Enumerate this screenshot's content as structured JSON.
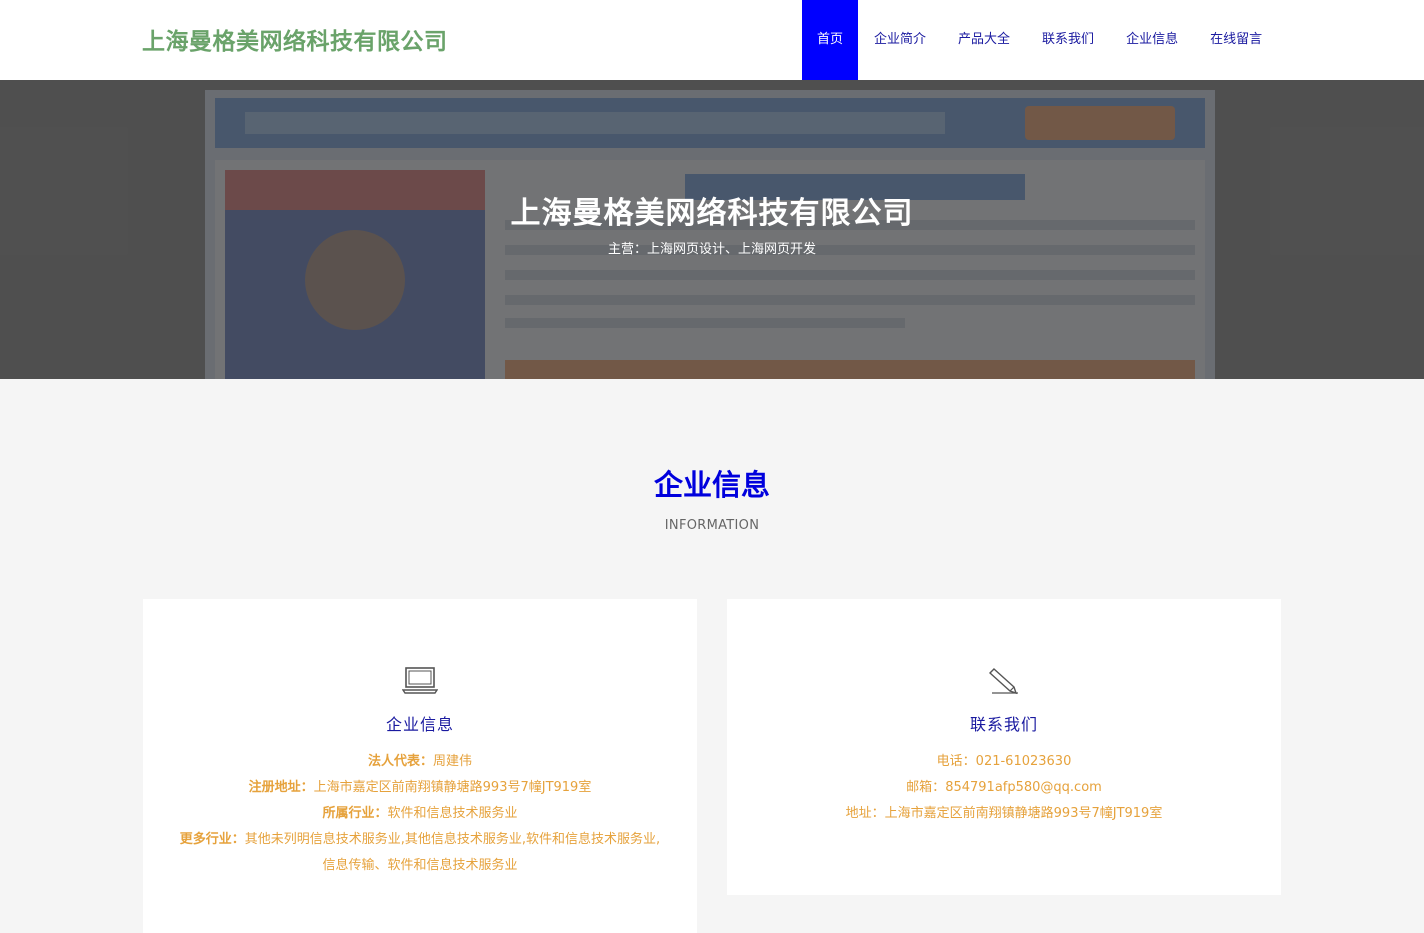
{
  "header": {
    "logo": "上海曼格美网络科技有限公司",
    "nav": [
      {
        "label": "首页",
        "active": true
      },
      {
        "label": "企业简介",
        "active": false
      },
      {
        "label": "产品大全",
        "active": false
      },
      {
        "label": "联系我们",
        "active": false
      },
      {
        "label": "企业信息",
        "active": false
      },
      {
        "label": "在线留言",
        "active": false
      }
    ]
  },
  "banner": {
    "title": "上海曼格美网络科技有限公司",
    "subtitle": "主营：上海网页设计、上海网页开发"
  },
  "section": {
    "title": "企业信息",
    "subtitle": "INFORMATION"
  },
  "info_card": {
    "icon": "laptop-icon",
    "title": "企业信息",
    "rows": [
      {
        "label": "法人代表：",
        "value": "周建伟"
      },
      {
        "label": "注册地址：",
        "value": "上海市嘉定区前南翔镇静塘路993号7幢JT919室"
      },
      {
        "label": "所属行业：",
        "value": "软件和信息技术服务业"
      },
      {
        "label": "更多行业：",
        "value": "其他未列明信息技术服务业,其他信息技术服务业,软件和信息技术服务业,信息传输、软件和信息技术服务业"
      }
    ]
  },
  "contact_card": {
    "icon": "pencil-icon",
    "title": "联系我们",
    "rows": [
      {
        "label": "电话：",
        "value": "021-61023630"
      },
      {
        "label": "邮箱：",
        "value": "854791afp580@qq.com"
      },
      {
        "label": "地址：",
        "value": "上海市嘉定区前南翔镇静塘路993号7幢JT919室"
      }
    ]
  },
  "colors": {
    "accent": "#0000ff",
    "logo": "#6aa36a",
    "highlight": "#e6a23c"
  }
}
